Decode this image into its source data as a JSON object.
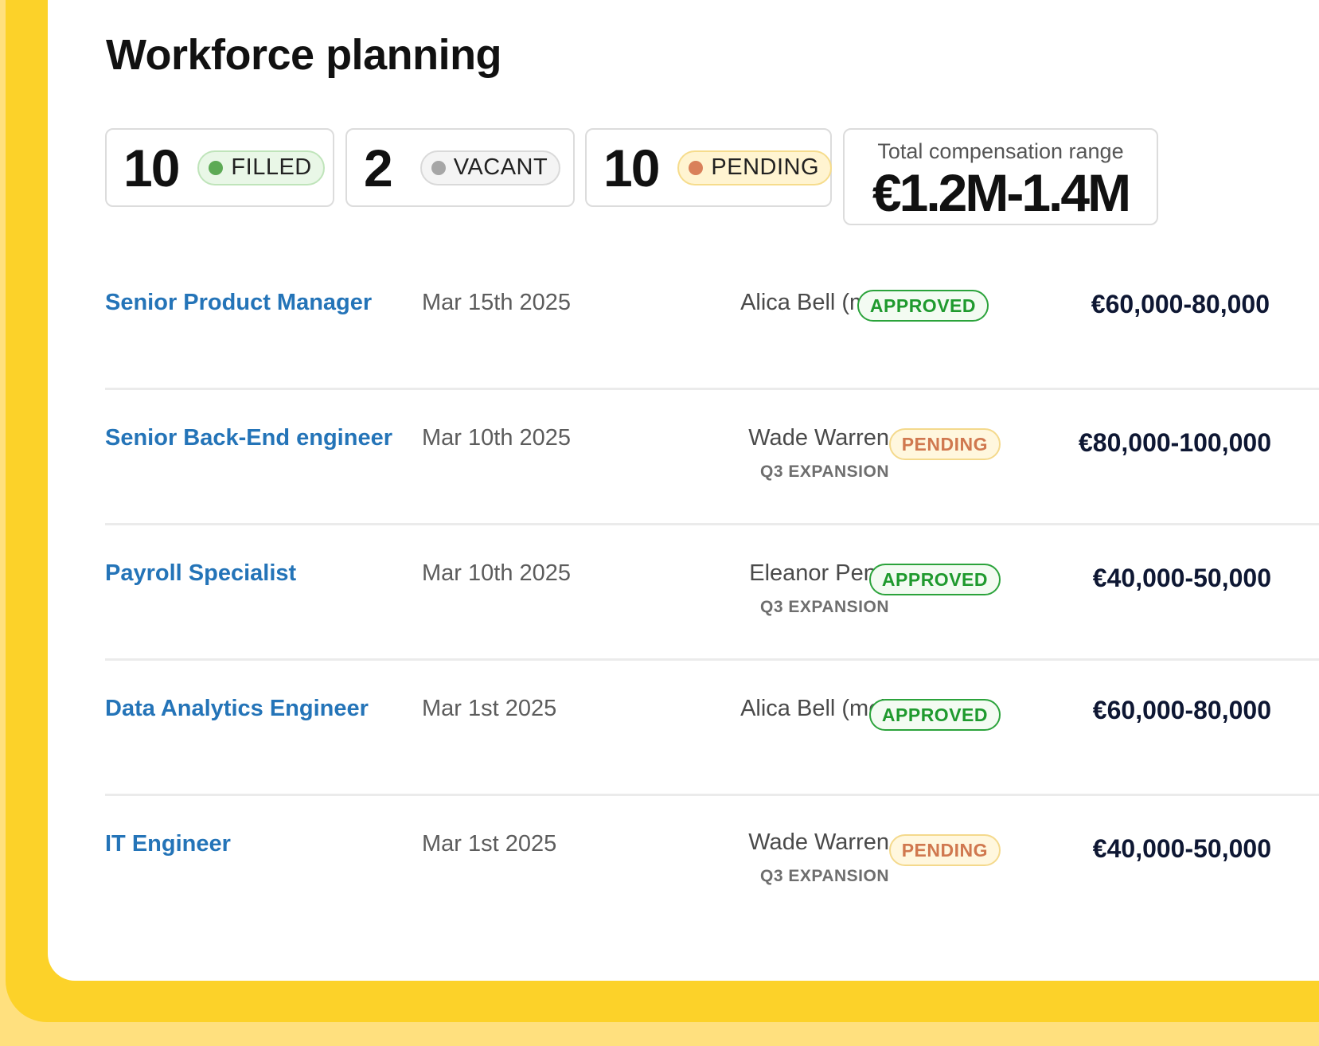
{
  "page_title": "Workforce planning",
  "stats": [
    {
      "count": "10",
      "label": "FILLED",
      "kind": "filled"
    },
    {
      "count": "2",
      "label": "VACANT",
      "kind": "vacant"
    },
    {
      "count": "10",
      "label": "PENDING",
      "kind": "pending"
    }
  ],
  "compensation": {
    "label": "Total compensation range",
    "value": "€1.2M-1.4M"
  },
  "rows": [
    {
      "role": "Senior Product Manager",
      "date": "Mar 15th 2025",
      "owner": "Alica Bell (me)",
      "tag": "",
      "status": "APPROVED",
      "amount": "€60,000-80,000"
    },
    {
      "role": "Senior Back-End engineer",
      "date": "Mar 10th 2025",
      "owner": "Wade Warren",
      "tag": "Q3 EXPANSION",
      "status": "PENDING",
      "amount": "€80,000-100,000"
    },
    {
      "role": "Payroll Specialist",
      "date": "Mar 10th 2025",
      "owner": "Eleanor Pena",
      "tag": "Q3 EXPANSION",
      "status": "APPROVED",
      "amount": "€40,000-50,000"
    },
    {
      "role": "Data Analytics Engineer",
      "date": "Mar 1st 2025",
      "owner": "Alica Bell (me)",
      "tag": "",
      "status": "APPROVED",
      "amount": "€60,000-80,000"
    },
    {
      "role": "IT Engineer",
      "date": "Mar 1st 2025",
      "owner": "Wade Warren",
      "tag": "Q3 EXPANSION",
      "status": "PENDING",
      "amount": "€40,000-50,000"
    }
  ],
  "colors": {
    "accent_link": "#2474B8",
    "frame_yellow": "#FCD229",
    "approved": "#2BA33B",
    "pending": "#D0784F"
  }
}
